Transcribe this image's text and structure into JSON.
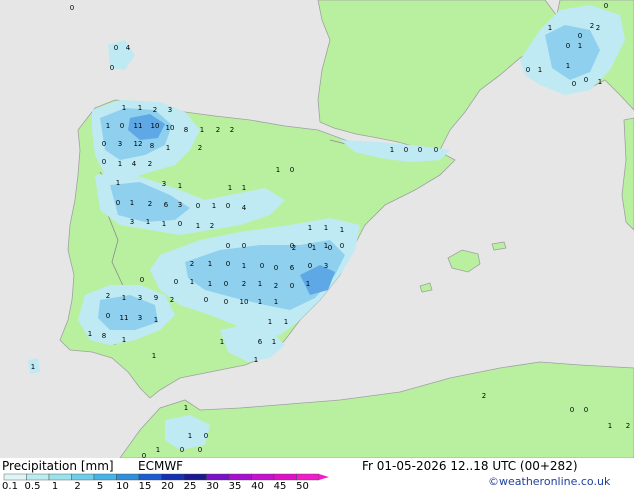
{
  "footer": {
    "title": "Precipitation [mm]",
    "model": "ECMWF",
    "valid_time": "Fr 01-05-2026 12..18 UTC (00+282)",
    "credit": "©weatheronline.co.uk"
  },
  "legend": {
    "ticks": [
      "0.1",
      "0.5",
      "1",
      "2",
      "5",
      "10",
      "15",
      "20",
      "25",
      "30",
      "35",
      "40",
      "45",
      "50"
    ],
    "colors": [
      "#e0f6f6",
      "#bdecf0",
      "#9ae2ec",
      "#6fcfe9",
      "#46b4e6",
      "#2f8fdb",
      "#1c5ccf",
      "#1630b0",
      "#1a1a8e",
      "#7a10c8",
      "#a810d0",
      "#c810d0",
      "#e010c8",
      "#f21cc8"
    ]
  },
  "colors": {
    "sea": "#e6e6e6",
    "land_dry": "#b9f0a0",
    "border": "#a0a0a0",
    "precip_light": "#bfeaf3",
    "precip_mid": "#8fd0ef",
    "precip_heavy": "#5fa8e6"
  },
  "map_labels": [
    "0",
    "0",
    "4",
    "0",
    "1",
    "0",
    "0",
    "2",
    "0",
    "1",
    "1",
    "0",
    "0",
    "1",
    "1",
    "0",
    "2",
    "1",
    "1",
    "2",
    "3",
    "1",
    "0",
    "11",
    "10",
    "10",
    "8",
    "1",
    "2",
    "2",
    "0",
    "3",
    "12",
    "8",
    "1",
    "2",
    "0",
    "1",
    "4",
    "2",
    "1",
    "3",
    "1",
    "1",
    "1",
    "0",
    "1",
    "0",
    "1",
    "2",
    "6",
    "3",
    "0",
    "1",
    "0",
    "4",
    "3",
    "1",
    "1",
    "0",
    "1",
    "2",
    "1",
    "1",
    "1",
    "0",
    "0",
    "0",
    "0",
    "1",
    "0",
    "2",
    "1",
    "0",
    "1",
    "0",
    "0",
    "6",
    "0",
    "3",
    "0",
    "0",
    "1",
    "1",
    "0",
    "2",
    "1",
    "2",
    "0",
    "1",
    "2",
    "1",
    "3",
    "9",
    "2",
    "0",
    "0",
    "10",
    "1",
    "1",
    "0",
    "11",
    "3",
    "1",
    "1",
    "1",
    "1",
    "8",
    "1",
    "1",
    "6",
    "1",
    "1",
    "1",
    "1",
    "1",
    "2",
    "0",
    "0",
    "1",
    "2",
    "1",
    "0",
    "1",
    "0",
    "0",
    "0",
    "1",
    "0",
    "0",
    "0",
    "2",
    "1",
    "0"
  ]
}
